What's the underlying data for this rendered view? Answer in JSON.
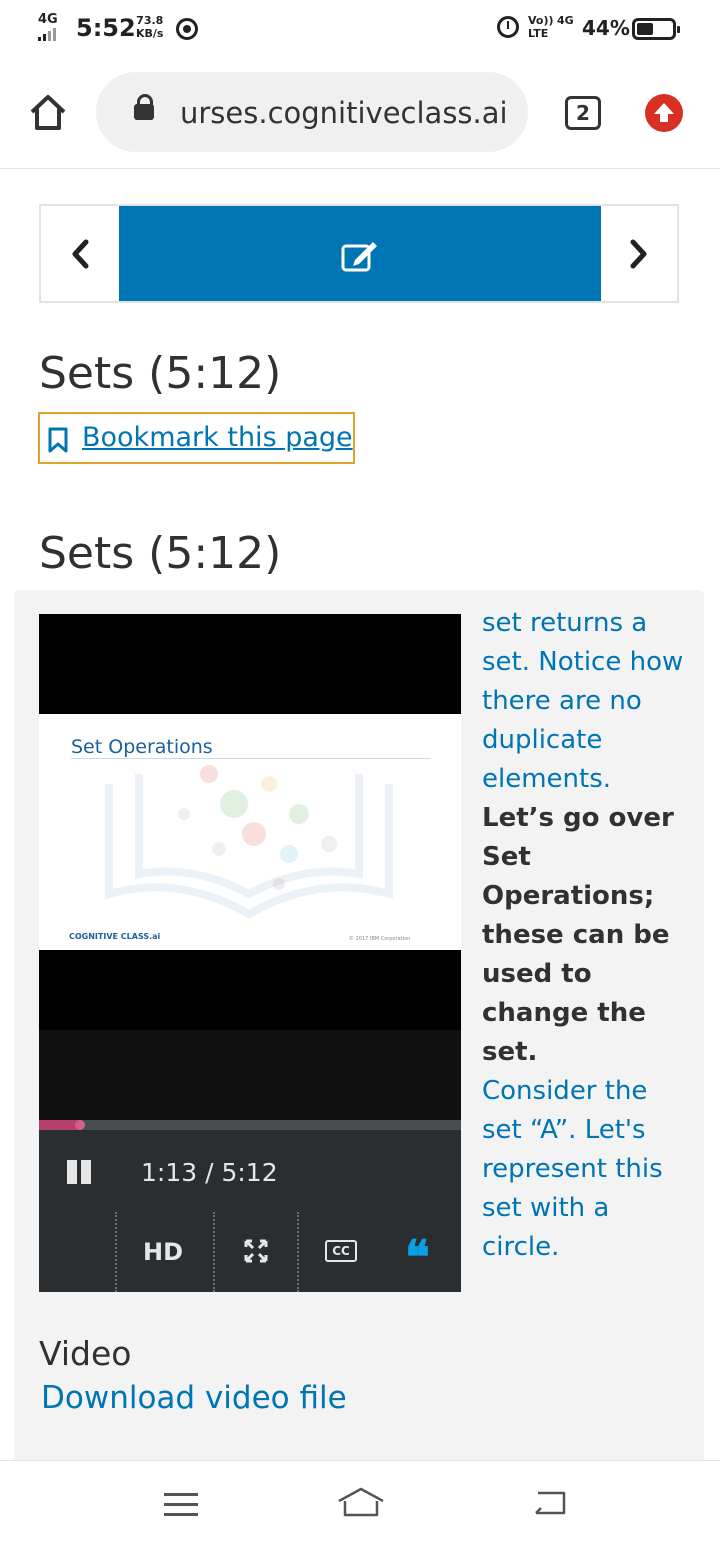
{
  "status_bar": {
    "network": "4G",
    "time": "5:52",
    "speed_value": "73.8",
    "speed_unit": "KB/s",
    "volte_top": "Vo))",
    "volte_bottom": "LTE",
    "network2": "4G",
    "battery_percent": "44%",
    "battery_level": 0.44
  },
  "browser": {
    "url": "urses.cognitiveclass.ai",
    "tab_count": "2"
  },
  "course_nav": {
    "prev_icon": "chevron-left-icon",
    "current_icon": "edit-icon",
    "next_icon": "chevron-right-icon",
    "accent": "#0075b4"
  },
  "unit": {
    "title": "Sets (5:12)",
    "bookmark_label": "Bookmark this page",
    "video_heading": "Sets (5:12)"
  },
  "video": {
    "slide_title": "Set Operations",
    "slide_logo": "COGNITIVE CLASS.ai",
    "slide_copyright": "© 2017 IBM Corporation",
    "time_display": "1:13 / 5:12",
    "progress": 0.233,
    "hd_label": "HD",
    "cc_label": "CC",
    "quote_label": "❝"
  },
  "transcript": {
    "before": "set returns a set. Notice how there are no duplicate elements.",
    "current": "Let’s go over Set Operations; these can be used to change the set.",
    "after": "Consider the set “A”. Let's represent this set with a circle."
  },
  "downloads": {
    "heading": "Video",
    "link_label": "Download video file"
  }
}
